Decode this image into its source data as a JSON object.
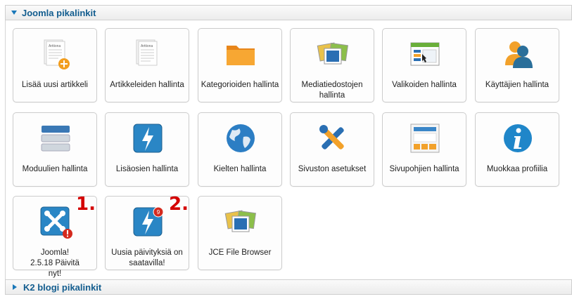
{
  "sections": {
    "main_title": "Joomla pikalinkit",
    "k2_title": "K2 blogi pikalinkit"
  },
  "tiles": [
    {
      "label": "Lisää uusi artikkeli"
    },
    {
      "label": "Artikkeleiden hallinta"
    },
    {
      "label": "Kategorioiden hallinta"
    },
    {
      "label": "Mediatiedostojen hallinta"
    },
    {
      "label": "Valikoiden hallinta"
    },
    {
      "label": "Käyttäjien hallinta"
    },
    {
      "label": "Moduulien hallinta"
    },
    {
      "label": "Lisäosien hallinta"
    },
    {
      "label": "Kielten hallinta"
    },
    {
      "label": "Sivuston asetukset"
    },
    {
      "label": "Sivupohjien hallinta"
    },
    {
      "label": "Muokkaa profiilia"
    },
    {
      "label": "Joomla! 2.5.18 Päivitä nyt!"
    },
    {
      "label": "Uusia päivityksiä on saatavilla!"
    },
    {
      "label": "JCE File Browser"
    }
  ],
  "markers": [
    "1.",
    "2."
  ],
  "icons": {
    "article_doc_title": "Arttiona",
    "extension_badge": "9"
  }
}
